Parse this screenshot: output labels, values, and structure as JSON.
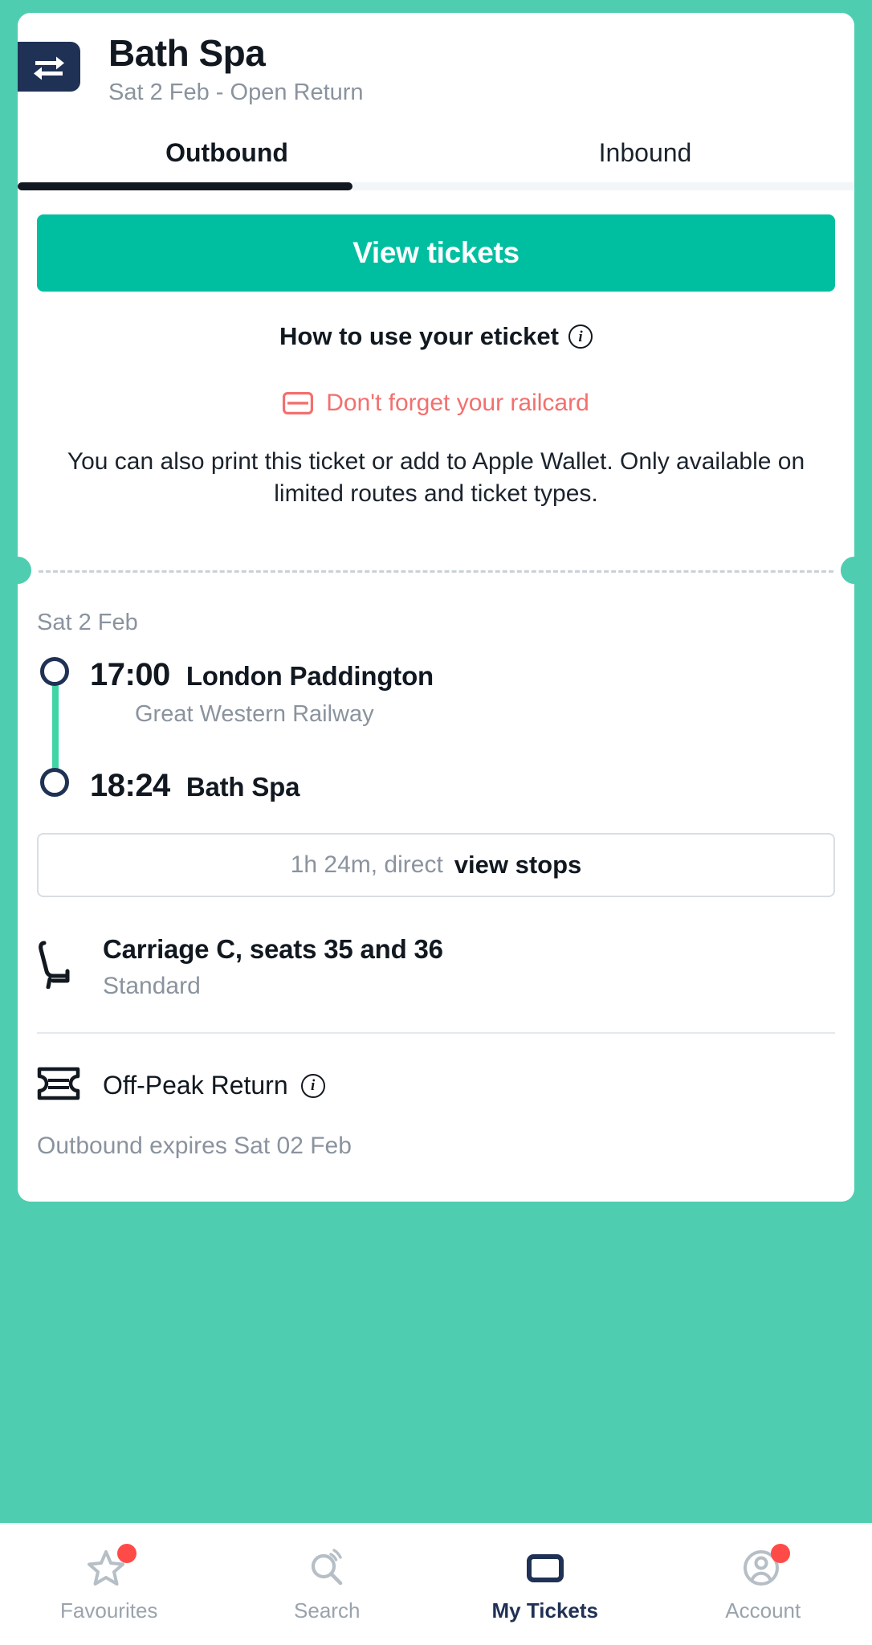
{
  "theme": {
    "background": "#4ECDB0",
    "accent_teal": "#00BFA0",
    "navy": "#1F3154",
    "alert_red": "#F2706E",
    "badge_red": "#FF4B48",
    "muted_text": "#8A939E"
  },
  "header": {
    "icon": "swap-arrows-icon",
    "title": "Bath Spa",
    "subtitle": "Sat 2 Feb - Open Return"
  },
  "tabs": [
    {
      "label": "Outbound",
      "active": true
    },
    {
      "label": "Inbound",
      "active": false
    }
  ],
  "eticket": {
    "view_tickets_label": "View tickets",
    "howto_label": "How to use your eticket",
    "howto_info_icon": "info-icon",
    "railcard_icon": "railcard-icon",
    "railcard_warning": "Don't forget your railcard",
    "print_note": "You can also print this ticket or add to Apple Wallet. Only available on limited routes and ticket types."
  },
  "journey": {
    "date": "Sat 2 Feb",
    "legs": [
      {
        "time": "17:00",
        "station": "London Paddington",
        "operator": "Great Western Railway"
      },
      {
        "time": "18:24",
        "station": "Bath Spa",
        "operator": ""
      }
    ],
    "duration": "1h 24m, direct",
    "view_stops_label": "view stops"
  },
  "seat": {
    "icon": "seat-icon",
    "title": "Carriage C, seats 35 and 36",
    "class": "Standard"
  },
  "fare": {
    "icon": "ticket-icon",
    "label": "Off-Peak Return",
    "info_icon": "info-icon",
    "expires": "Outbound expires Sat 02 Feb"
  },
  "bottom_nav": [
    {
      "label": "Favourites",
      "icon": "star-icon",
      "active": false,
      "badge": true
    },
    {
      "label": "Search",
      "icon": "search-icon",
      "active": false,
      "badge": false
    },
    {
      "label": "My Tickets",
      "icon": "tickets-icon",
      "active": true,
      "badge": false
    },
    {
      "label": "Account",
      "icon": "account-icon",
      "active": false,
      "badge": true
    }
  ]
}
